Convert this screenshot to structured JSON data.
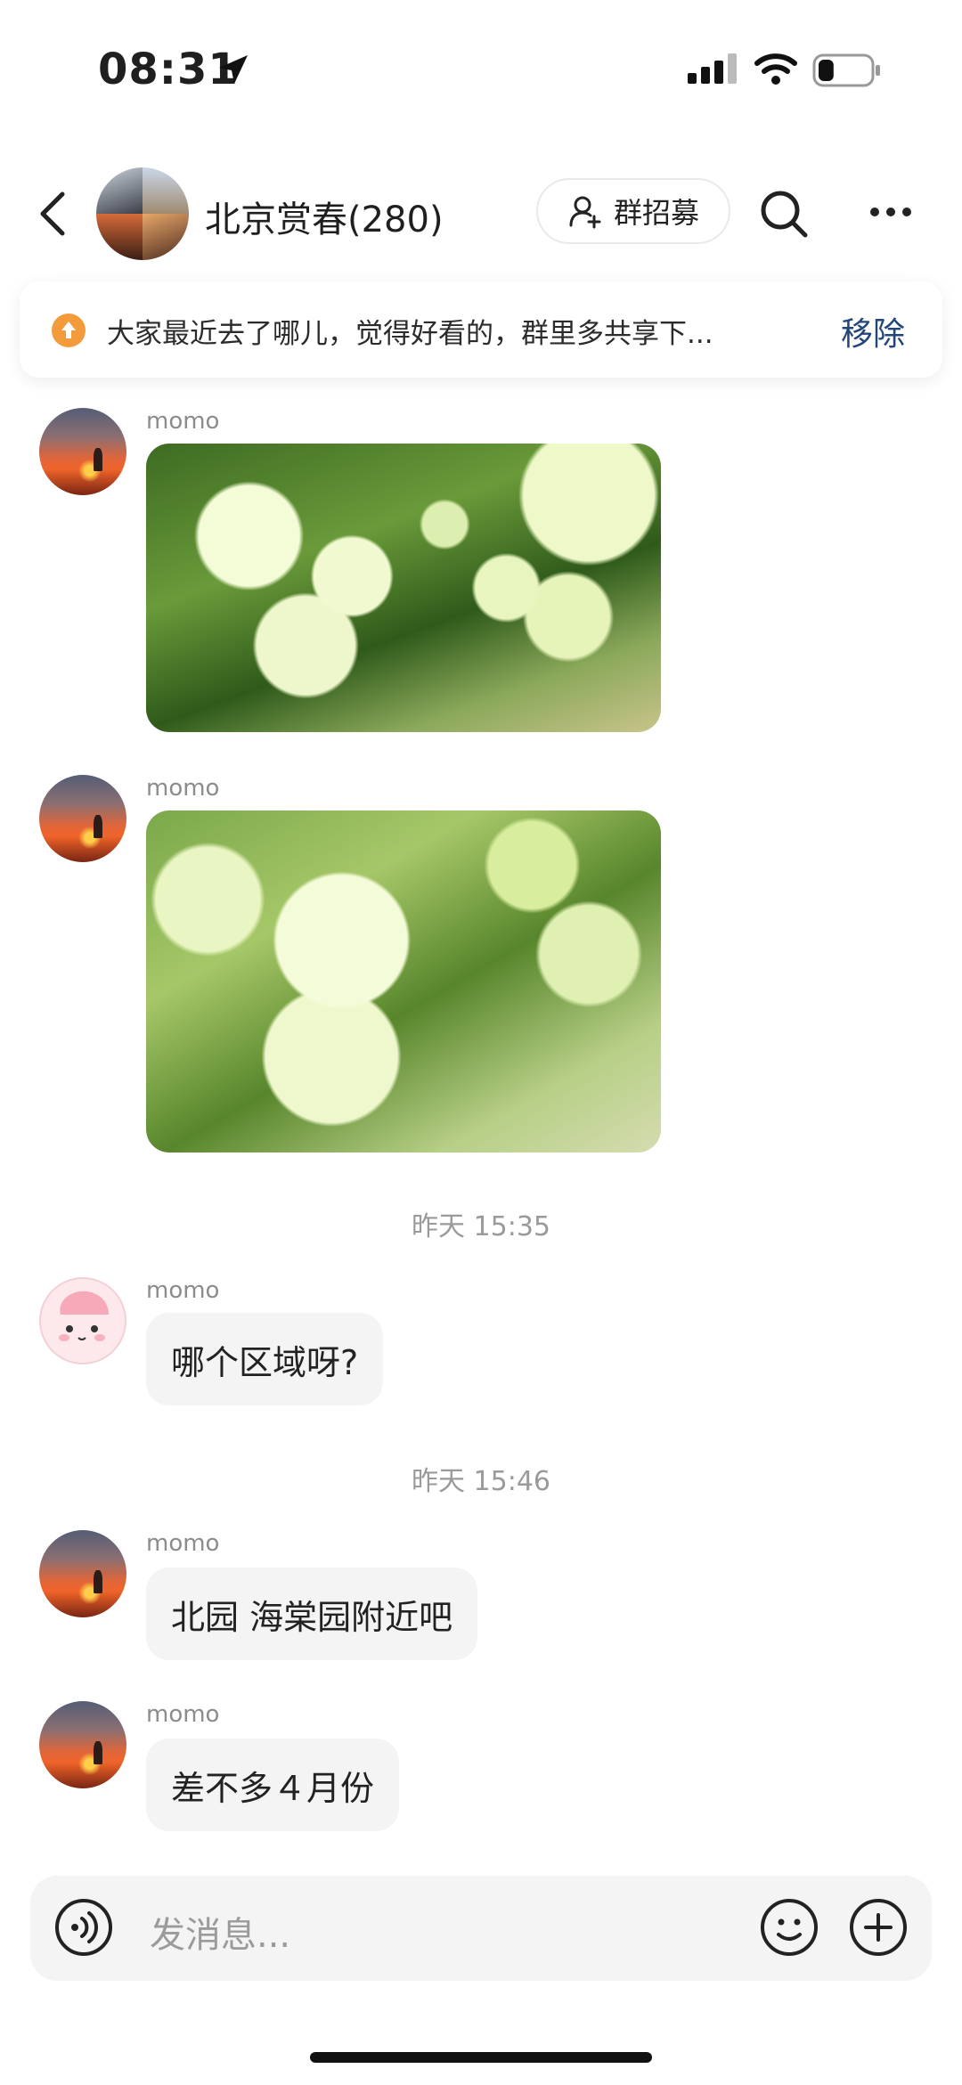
{
  "status_bar": {
    "time": "08:31",
    "battery_level": 0.3
  },
  "header": {
    "back_icon": "chevron-left-icon",
    "title": "北京赏春(280)",
    "recruit_label": "群招募",
    "recruit_icon": "add-user-icon",
    "search_icon": "search-icon",
    "more_icon": "more-icon"
  },
  "pinned": {
    "icon": "pin-up-arrow-icon",
    "text": "大家最近去了哪儿，觉得好看的，群里多共享下...",
    "remove_label": "移除",
    "accent_color": "#f39a3a"
  },
  "messages": [
    {
      "sender": "momo",
      "type": "image"
    },
    {
      "sender": "momo",
      "type": "image"
    },
    {
      "timestamp": "昨天 15:35"
    },
    {
      "sender": "momo",
      "type": "text",
      "text": "哪个区域呀?"
    },
    {
      "timestamp": "昨天 15:46"
    },
    {
      "sender": "momo",
      "type": "text",
      "text": "北园 海棠园附近吧"
    },
    {
      "sender": "momo",
      "type": "text",
      "text": "差不多４月份"
    }
  ],
  "input": {
    "placeholder": "发消息...",
    "voice_icon": "voice-icon",
    "emoji_icon": "emoji-icon",
    "plus_icon": "plus-icon"
  },
  "colors": {
    "bubble": "#f4f4f4",
    "link": "#23467a"
  }
}
